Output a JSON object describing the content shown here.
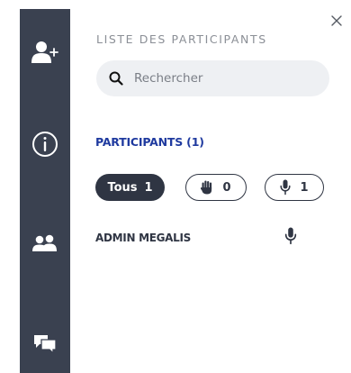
{
  "sidebar": {
    "items": [
      {
        "icon": "add-user-icon"
      },
      {
        "icon": "info-icon"
      },
      {
        "icon": "participants-icon"
      },
      {
        "icon": "chat-icon"
      }
    ],
    "background": "#3a4150"
  },
  "panel": {
    "title": "LISTE DES PARTICIPANTS",
    "close_icon": "close-icon"
  },
  "search": {
    "placeholder": "Rechercher",
    "value": "",
    "icon": "search-icon"
  },
  "participants": {
    "section_title": "PARTICIPANTS (1)",
    "filters": [
      {
        "label": "Tous",
        "count": "1",
        "selected": true
      },
      {
        "icon": "raised-hand-icon",
        "count": "0",
        "selected": false
      },
      {
        "icon": "microphone-icon",
        "count": "1",
        "selected": false
      }
    ],
    "list": [
      {
        "name": "ADMIN MEGALIS",
        "icon": "microphone-icon"
      }
    ]
  },
  "colors": {
    "accent": "#1f3a9f",
    "dark": "#2f3543",
    "muted": "#8b8f96",
    "search_bg": "#eef0f3"
  }
}
